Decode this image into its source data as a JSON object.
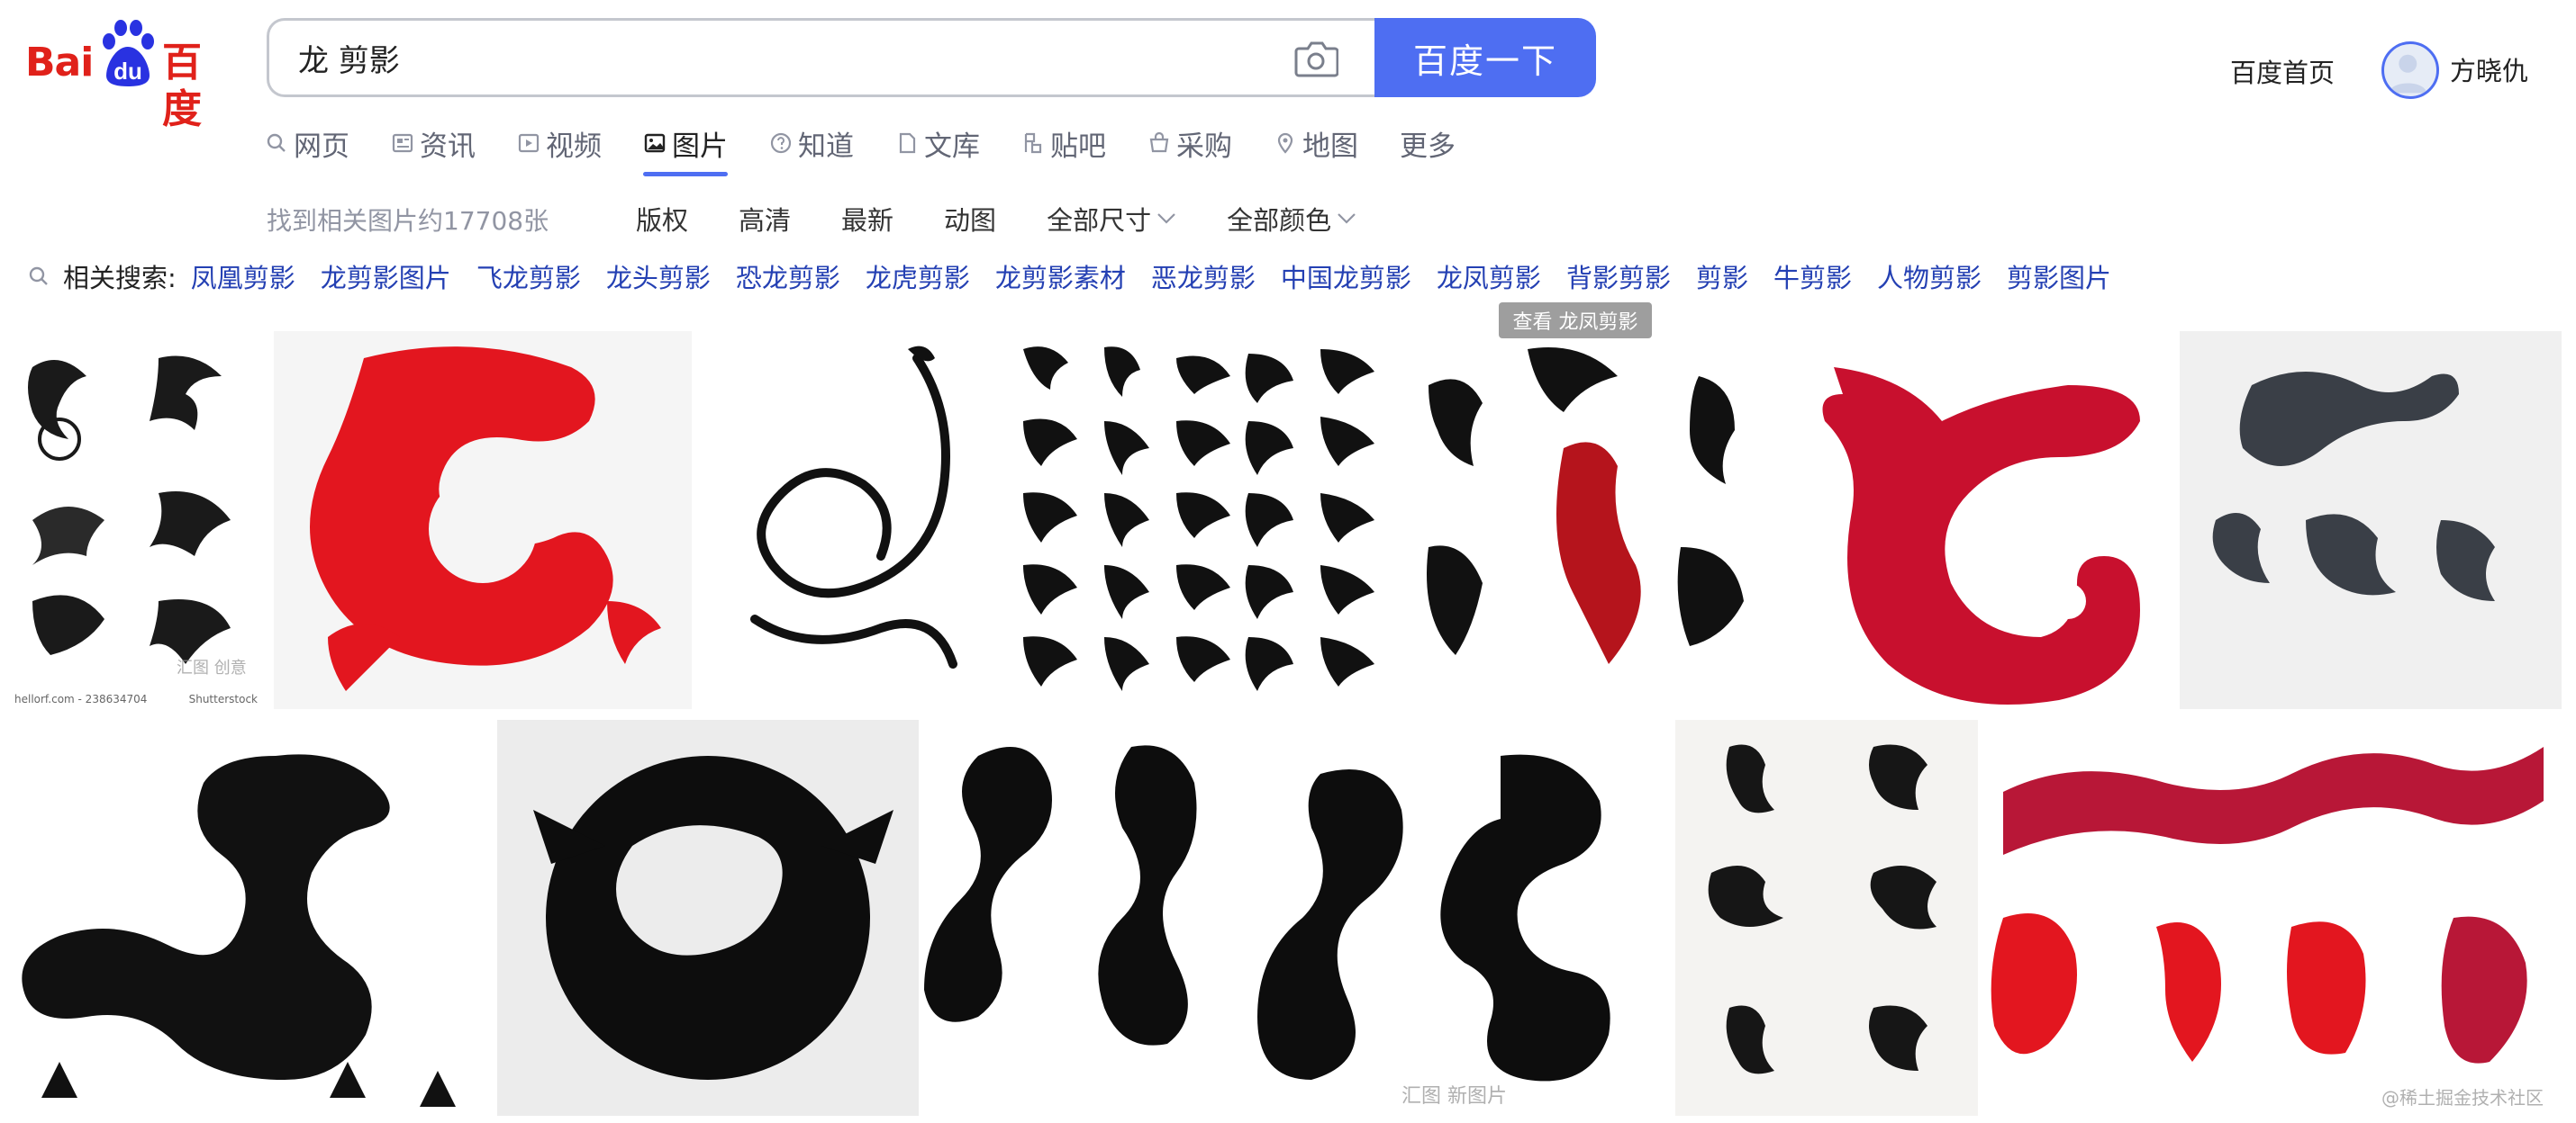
{
  "logo": {
    "text_left": "Bai",
    "text_paw": "du",
    "text_right": "百度"
  },
  "search": {
    "query": "龙 剪影",
    "button_label": "百度一下",
    "camera_icon": "camera-icon"
  },
  "header": {
    "home_link": "百度首页",
    "username": "方晓仇"
  },
  "tabs": [
    {
      "label": "网页",
      "icon": "search-icon"
    },
    {
      "label": "资讯",
      "icon": "news-icon"
    },
    {
      "label": "视频",
      "icon": "video-icon"
    },
    {
      "label": "图片",
      "icon": "image-icon",
      "active": true
    },
    {
      "label": "知道",
      "icon": "question-icon"
    },
    {
      "label": "文库",
      "icon": "document-icon"
    },
    {
      "label": "贴吧",
      "icon": "forum-icon"
    },
    {
      "label": "采购",
      "icon": "shop-icon"
    },
    {
      "label": "地图",
      "icon": "map-icon"
    },
    {
      "label": "更多"
    }
  ],
  "results": {
    "count_text": "找到相关图片约17708张"
  },
  "filters": [
    {
      "label": "版权"
    },
    {
      "label": "高清"
    },
    {
      "label": "最新"
    },
    {
      "label": "动图"
    },
    {
      "label": "全部尺寸",
      "dropdown": true
    },
    {
      "label": "全部颜色",
      "dropdown": true
    }
  ],
  "related": {
    "label": "相关搜索:",
    "items": [
      "凤凰剪影",
      "龙剪影图片",
      "飞龙剪影",
      "龙头剪影",
      "恐龙剪影",
      "龙虎剪影",
      "龙剪影素材",
      "恶龙剪影",
      "中国龙剪影",
      "龙凤剪影",
      "背影剪影",
      "剪影",
      "牛剪影",
      "人物剪影",
      "剪影图片"
    ]
  },
  "hover_tip": "查看 龙凤剪影",
  "images": {
    "img1": {
      "caption_left": "hellorf.com - 238634704",
      "caption_right": "Shutterstock",
      "watermark": "汇图 创意"
    },
    "img12": {
      "watermark": "@稀土掘金技术社区"
    },
    "img10": {
      "watermark": "汇图 新图片"
    }
  },
  "colors": {
    "accent": "#4e6ef2",
    "brand_red": "#e0211a",
    "link": "#2440b3",
    "dragon_red": "#e3161f",
    "dragon_crimson": "#b81737"
  }
}
